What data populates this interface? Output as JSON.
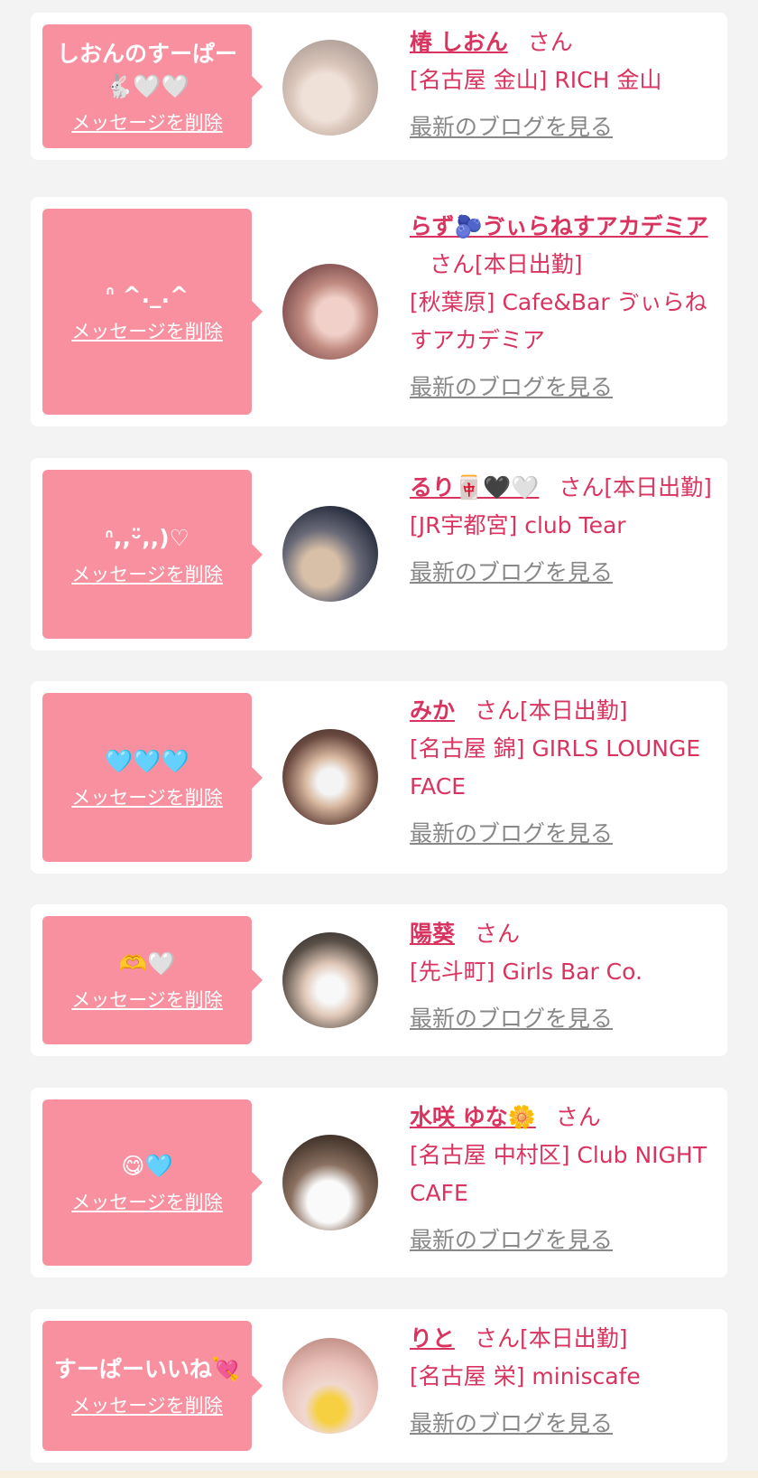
{
  "delete_label": "メッセージを削除",
  "blog_label": "最新のブログを見る",
  "san_label": "さん",
  "items": [
    {
      "message": "しおんのすーぱー\n🐇🤍🤍",
      "name": "椿 しおん",
      "suffix": "さん",
      "shop": "[名古屋 金山] RICH 金山"
    },
    {
      "message": "ᐢ ^._.^",
      "name": "らず🫐ゔぃらねすアカデミア",
      "suffix": "さん[本日出勤]",
      "shop": "[秋葉原] Cafe&Bar ゔぃらねすアカデミア"
    },
    {
      "message": "ᐢ,,ᵕ̈,,)♡",
      "name": "るり🀄🖤🤍",
      "suffix": "さん[本日出勤]",
      "shop": "[JR宇都宮] club Tear"
    },
    {
      "message": "🩵🩵🩵",
      "name": "みか",
      "suffix": "さん[本日出勤]",
      "shop": "[名古屋 錦] GIRLS LOUNGE FACE"
    },
    {
      "message": "🫶🤍",
      "name": "陽葵",
      "suffix": "さん",
      "shop": "[先斗町] Girls Bar Co."
    },
    {
      "message": "😋🩵",
      "name": "水咲 ゆな🌼",
      "suffix": "さん",
      "shop": "[名古屋 中村区] Club NIGHT CAFE"
    },
    {
      "message": "すーぱーいいね💘",
      "name": "りと",
      "suffix": "さん[本日出勤]",
      "shop": "[名古屋 栄] miniscafe"
    }
  ],
  "colors": {
    "accent": "#d9345f",
    "bubble": "#f8909f",
    "link_gray": "#888888",
    "background": "#f3f3f3"
  }
}
